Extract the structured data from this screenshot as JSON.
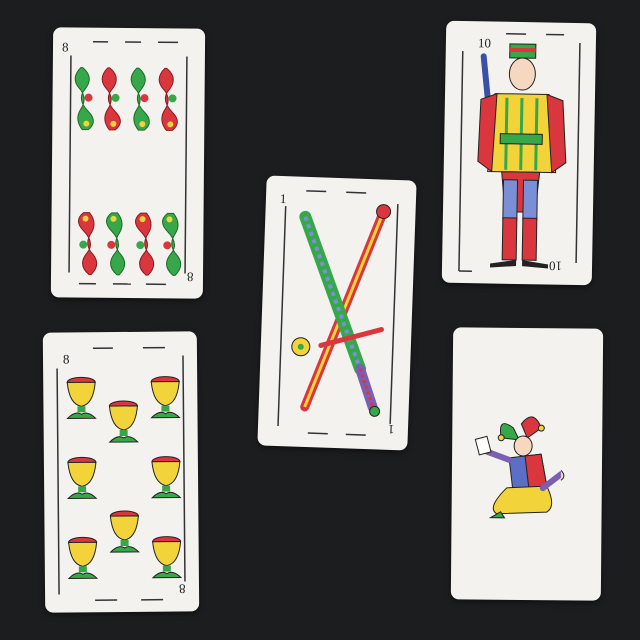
{
  "scene": "five Spanish playing cards on a dark table",
  "cards": [
    {
      "name": "eight of clubs",
      "suit": "bastos",
      "rank": "8"
    },
    {
      "name": "ten of swords",
      "suit": "espadas",
      "rank": "10"
    },
    {
      "name": "one of swords",
      "suit": "espadas",
      "rank": "1"
    },
    {
      "name": "eight of cups",
      "suit": "copas",
      "rank": "8"
    },
    {
      "name": "joker",
      "suit": "comodin",
      "rank": ""
    }
  ],
  "colors": {
    "table": "#1c1d1f",
    "card": "#f4f2ef",
    "red": "#d9363e",
    "green": "#36a84a",
    "yellow": "#f2d33a",
    "blue": "#5b6fc6"
  }
}
